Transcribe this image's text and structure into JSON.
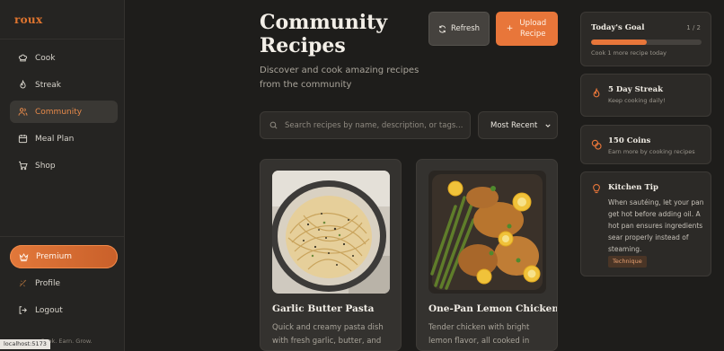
{
  "app": {
    "logo": "roux",
    "footer": "Cook. Earn. Grow.",
    "url_tooltip": "localhost:5173"
  },
  "sidebar": {
    "items": [
      {
        "label": "Cook",
        "icon": "chef-hat-icon",
        "active": false
      },
      {
        "label": "Streak",
        "icon": "flame-icon",
        "active": false
      },
      {
        "label": "Community",
        "icon": "users-icon",
        "active": true
      },
      {
        "label": "Meal Plan",
        "icon": "calendar-icon",
        "active": false
      },
      {
        "label": "Shop",
        "icon": "cart-icon",
        "active": false
      }
    ],
    "premium_label": "Premium",
    "profile_label": "Profile",
    "logout_label": "Logout"
  },
  "header": {
    "title": "Community Recipes",
    "subtitle": "Discover and cook amazing recipes from the community",
    "refresh_label": "Refresh",
    "upload_label": "Upload Recipe"
  },
  "search": {
    "placeholder": "Search recipes by name, description, or tags...",
    "value": ""
  },
  "sort": {
    "selected": "Most Recent"
  },
  "recipes": [
    {
      "title": "Garlic Butter Pasta",
      "description": "Quick and creamy pasta dish with fresh garlic, butter, and parmesan. Perfect for busy"
    },
    {
      "title": "One-Pan Lemon Chicken",
      "description": "Tender chicken with bright lemon flavor, all cooked in one pan for easy cleanup"
    }
  ],
  "goal": {
    "title": "Today's Goal",
    "count": "1 / 2",
    "progress": 0.5,
    "subtitle": "Cook 1 more recipe today"
  },
  "streak": {
    "title": "5 Day Streak",
    "subtitle": "Keep cooking daily!"
  },
  "coins": {
    "title": "150 Coins",
    "subtitle": "Earn more by cooking recipes"
  },
  "tip": {
    "title": "Kitchen Tip",
    "text": "When sautéing, let your pan get hot before adding oil. A hot pan ensures ingredients sear properly instead of steaming.",
    "tag": "Technique"
  },
  "colors": {
    "accent": "#e8763a",
    "background": "#1e1d1b",
    "card": "#34322f"
  }
}
